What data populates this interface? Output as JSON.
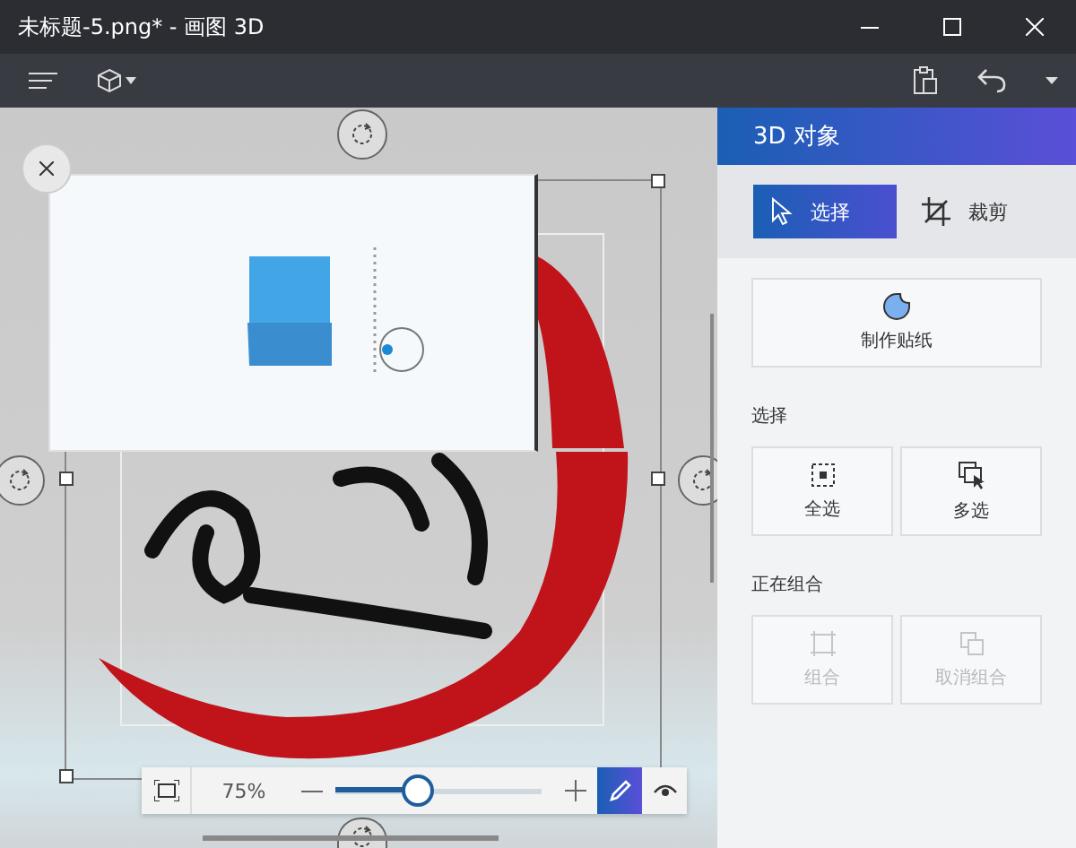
{
  "window": {
    "title": "未标题-5.png* - 画图 3D"
  },
  "panel": {
    "title": "3D 对象",
    "tabs": [
      {
        "label": "选择",
        "selected": true,
        "kind": "select"
      },
      {
        "label": "裁剪",
        "selected": false,
        "kind": "crop"
      }
    ],
    "sticker_button": {
      "label": "制作贴纸"
    },
    "sections": [
      {
        "title": "选择",
        "buttons": [
          {
            "label": "全选",
            "kind": "select-all",
            "disabled": false
          },
          {
            "label": "多选",
            "kind": "multi-select",
            "disabled": false
          }
        ]
      },
      {
        "title": "正在组合",
        "buttons": [
          {
            "label": "组合",
            "kind": "group",
            "disabled": true
          },
          {
            "label": "取消组合",
            "kind": "ungroup",
            "disabled": true
          }
        ]
      }
    ]
  },
  "zoom_bar": {
    "reading": "75%",
    "level": 0.38,
    "modes": [
      {
        "kind": "pen",
        "selected": true
      },
      {
        "kind": "eye",
        "selected": false
      }
    ]
  }
}
